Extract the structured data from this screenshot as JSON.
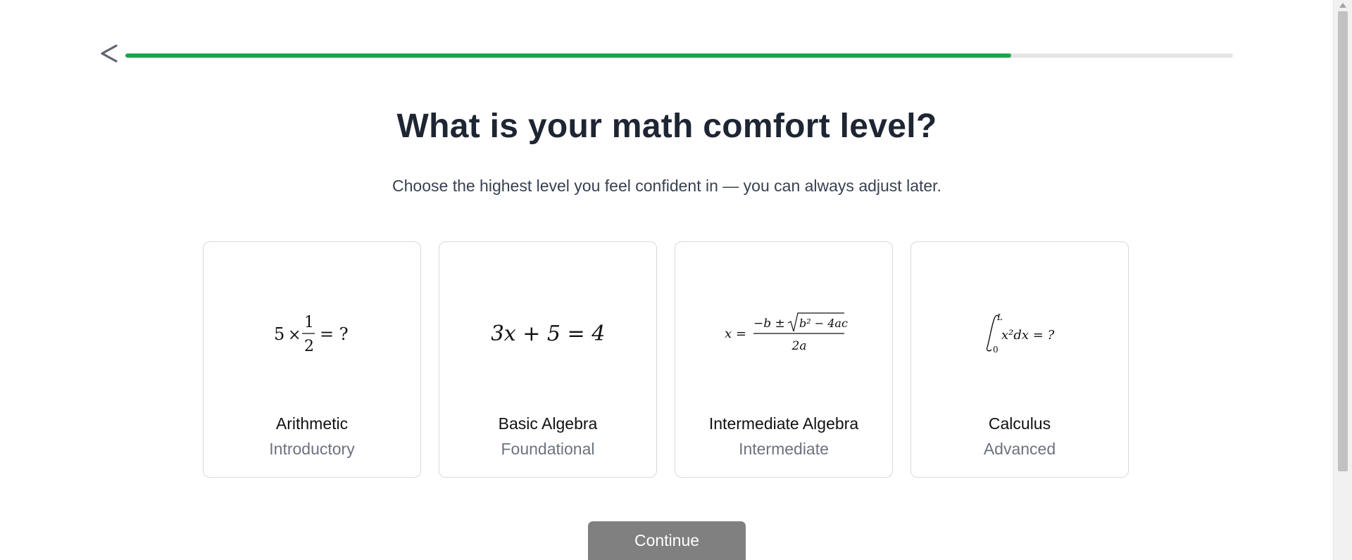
{
  "header": {
    "back_icon": "chevron-left-icon",
    "progress": 0.8,
    "progress_color": "#1fa34a"
  },
  "title": "What is your math comfort level?",
  "subtitle": "Choose the highest level you feel confident in — you can always adjust later.",
  "options": [
    {
      "name": "Arithmetic",
      "level": "Introductory",
      "formula": {
        "a": "5",
        "times": "×",
        "num": "1",
        "den": "2",
        "rest": "= ?"
      }
    },
    {
      "name": "Basic Algebra",
      "level": "Foundational",
      "formula": {
        "text": "3x + 5 = 4"
      }
    },
    {
      "name": "Intermediate Algebra",
      "level": "Intermediate",
      "formula": {
        "lhs": "x =",
        "num_pre": "−b ±",
        "radicand": "b² − 4ac",
        "den": "2a"
      }
    },
    {
      "name": "Calculus",
      "level": "Advanced",
      "formula": {
        "upper": "L",
        "lower": "0",
        "integrand": "x²dx = ?"
      }
    }
  ],
  "continue_label": "Continue",
  "colors": {
    "accent": "#1fa34a",
    "button_disabled": "#808080",
    "title": "#1e2533"
  }
}
